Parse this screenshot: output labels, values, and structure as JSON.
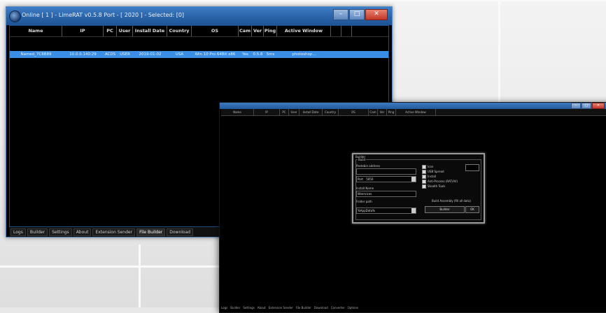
{
  "colors": {
    "accent": "#2a63a8",
    "selection": "#3a8ee6",
    "background": "#000000"
  },
  "win1": {
    "title": "Online [ 1 ] - LimeRAT v0.5.8 Port - [ 2020 ] - Selected: [0]",
    "columns": [
      "Name",
      "IP",
      "PC",
      "User",
      "Install Date",
      "Country",
      "OS",
      "Cam",
      "Ver",
      "Ping",
      "Active Window",
      "",
      ""
    ],
    "row": [
      "Named_7C8B89",
      "10.0.0.140:29",
      "ACDS",
      "USER",
      "2019-01-02",
      "USA",
      "Win 10 Pro 64Bit x86",
      "Yes",
      "0.5.8",
      "5ms",
      "photoshop...",
      "",
      ""
    ],
    "tabs": [
      "Logs",
      "Builder",
      "Settings",
      "About",
      "Extension Sender",
      "File Builder",
      "Download"
    ],
    "active_tab": "File Builder"
  },
  "win2": {
    "columns": [
      "Name",
      "IP",
      "PC",
      "User",
      "Install Date",
      "Country",
      "OS",
      "Cam",
      "Ver",
      "Ping",
      "Active Window"
    ],
    "tabs": [
      "Logs",
      "Builder",
      "Settings",
      "About",
      "Extension Sender",
      "File Builder",
      "Download",
      "Converter",
      "Options"
    ]
  },
  "dialog": {
    "title": "Builder",
    "section": "Build",
    "host_label": "Pastebin address",
    "port_label": "Port",
    "port_value": "5050",
    "install_label": "Install Name",
    "install_value": "Wservices",
    "folder_label": "Folder path",
    "folder_value": "%AppData%",
    "checks": [
      "Icon",
      "USB Spread",
      "Install",
      "Anti-Process (RAT/AV)",
      "Stealth Tools"
    ],
    "info": "Build Assembly (fill all data)",
    "build_button": "Builder",
    "ok_button": "OK"
  }
}
